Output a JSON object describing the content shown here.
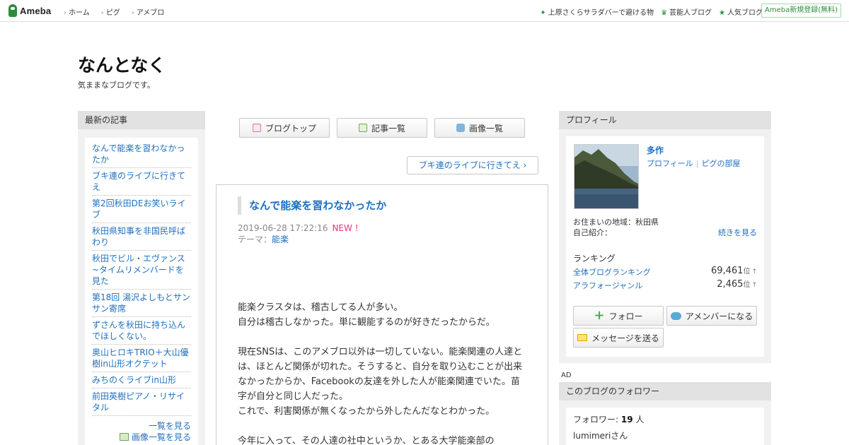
{
  "topbar": {
    "logo_text": "Ameba",
    "nav": [
      "ホーム",
      "ピグ",
      "アメブロ"
    ],
    "links": [
      "上原さくらサラダバーで避ける物",
      "芸能人ブログ",
      "人気ブログ"
    ],
    "signup": "Ameba新規登録(無料)"
  },
  "blog": {
    "title": "なんとなく",
    "description": "気ままなブログです。"
  },
  "recent": {
    "heading": "最新の記事",
    "items": [
      "なんで能楽を習わなかったか",
      "ブキ連のライブに行きてえ",
      "第2回秋田DEお笑いライブ",
      "秋田県知事を非国民呼ばわり",
      "秋田でビル・エヴァンス~タイムリメンバードを見た",
      "第18回 湯沢よしもとサンサン寄席",
      "ずさんを秋田に持ち込んでほしくない。",
      "奥山ヒロキTRIO＋大山優樹in山形オクテット",
      "みちのくライブin山形",
      "前田英樹ピアノ・リサイタル"
    ],
    "more_list": "一覧を見る",
    "more_images": "画像一覧を見る"
  },
  "center": {
    "buttons": [
      "ブログトップ",
      "記事一覧",
      "画像一覧"
    ],
    "next_link": "ブキ連のライブに行きてえ ›"
  },
  "article": {
    "title": "なんで能楽を習わなかったか",
    "datetime": "2019-06-28 17:22:16",
    "new_badge": "NEW !",
    "theme_label": "テーマ：",
    "theme": "能楽",
    "paragraphs": [
      [
        "能楽クラスタは、稽古してる人が多い。",
        "自分は稽古しなかった。単に観能するのが好きだったからだ。"
      ],
      [
        "現在SNSは、このアメブロ以外は一切していない。能楽関連の人達とは、ほとんど関係が切れた。そうすると、自分を取り込むことが出来なかったからか、Facebookの友達を外した人が能楽関連でいた。苗字が自分と同じ人だった。",
        "これで、利害関係が無くなったから外したんだなとわかった。"
      ],
      [
        "今年に入って、その人達の社中というか、とある大学能楽部の"
      ]
    ]
  },
  "profile": {
    "heading": "プロフィール",
    "name": "多作",
    "link_profile": "プロフィール",
    "link_pigg": "ピグの部屋",
    "area": "お住まいの地域：秋田県",
    "intro_label": "自己紹介：",
    "intro_more": "続きを見る",
    "ranking_heading": "ランキング",
    "rankings": [
      {
        "label": "全体ブログランキング",
        "value": "69,461",
        "unit": "位",
        "arrow": "↑"
      },
      {
        "label": "アラフォージャンル",
        "value": "2,465",
        "unit": "位",
        "arrow": "↑"
      }
    ],
    "follow_button": "フォロー",
    "member_button": "アメンバーになる",
    "message_button": "メッセージを送る"
  },
  "ad_label": "AD",
  "followers": {
    "heading": "このブログのフォロワー",
    "label": "フォロワー: ",
    "count": "19",
    "unit": " 人",
    "first_user": "lumimeriさん"
  },
  "colors": {
    "accent_green": "#2d8c3c",
    "link_blue": "#1e6fbf",
    "new_pink": "#e8317d"
  }
}
